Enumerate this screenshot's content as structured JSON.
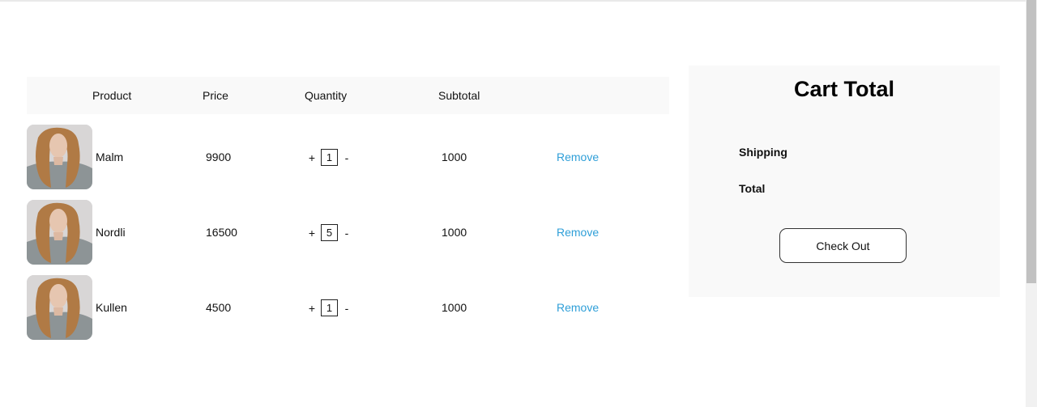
{
  "table": {
    "headers": {
      "product": "Product",
      "price": "Price",
      "quantity": "Quantity",
      "subtotal": "Subtotal"
    },
    "qty_plus": "+",
    "qty_minus": "-",
    "remove_label": "Remove",
    "rows": [
      {
        "name": "Malm",
        "price": "9900",
        "quantity": "1",
        "subtotal": "1000"
      },
      {
        "name": "Nordli",
        "price": "16500",
        "quantity": "5",
        "subtotal": "1000"
      },
      {
        "name": "Kullen",
        "price": "4500",
        "quantity": "1",
        "subtotal": "1000"
      }
    ]
  },
  "cart_total": {
    "title": "Cart Total",
    "shipping_label": "Shipping",
    "total_label": "Total",
    "checkout_label": "Check Out"
  },
  "colors": {
    "accent_link": "#2f9fd8",
    "panel_bg": "#f9f9f9"
  }
}
